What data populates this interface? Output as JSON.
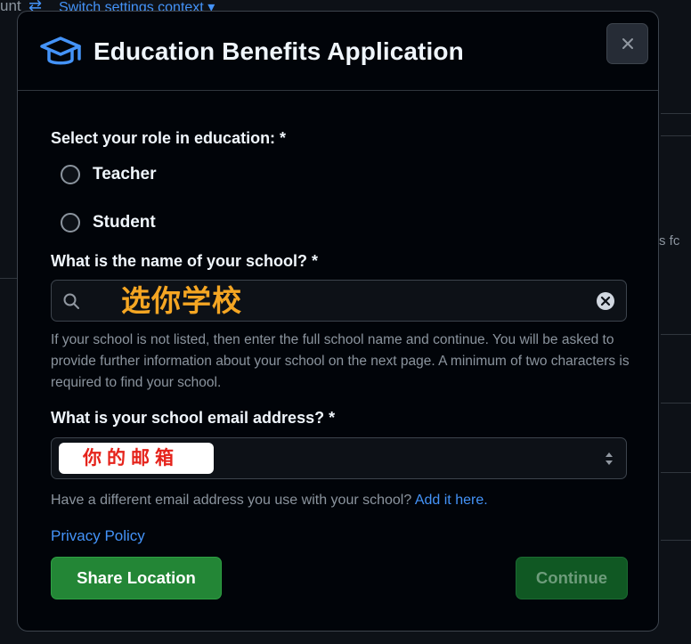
{
  "background": {
    "top_fragment": "unt",
    "switch_context_label": "Switch settings context",
    "side_fragment": "s fc"
  },
  "modal": {
    "title": "Education Benefits Application",
    "close_label": "✕"
  },
  "role": {
    "label": "Select your role in education: *",
    "options": [
      "Teacher",
      "Student"
    ]
  },
  "school": {
    "label": "What is the name of your school? *",
    "value": "选你学校",
    "help": "If your school is not listed, then enter the full school name and continue. You will be asked to provide further information about your school on the next page. A minimum of two characters is required to find your school."
  },
  "email": {
    "label": "What is your school email address? *",
    "value": "你的邮箱",
    "alt_prompt": "Have a different email address you use with your school?",
    "alt_link": "Add it here."
  },
  "privacy_link": "Privacy Policy",
  "buttons": {
    "share": "Share Location",
    "continue": "Continue"
  },
  "colors": {
    "accent_link": "#4493f8",
    "primary_button": "#238636",
    "annotation_orange": "#f5a623",
    "annotation_red": "#e5231b"
  },
  "icons": [
    "graduation-cap-icon",
    "close-icon",
    "search-icon",
    "clear-icon",
    "updown-arrows-icon",
    "arrows-swap-icon"
  ]
}
